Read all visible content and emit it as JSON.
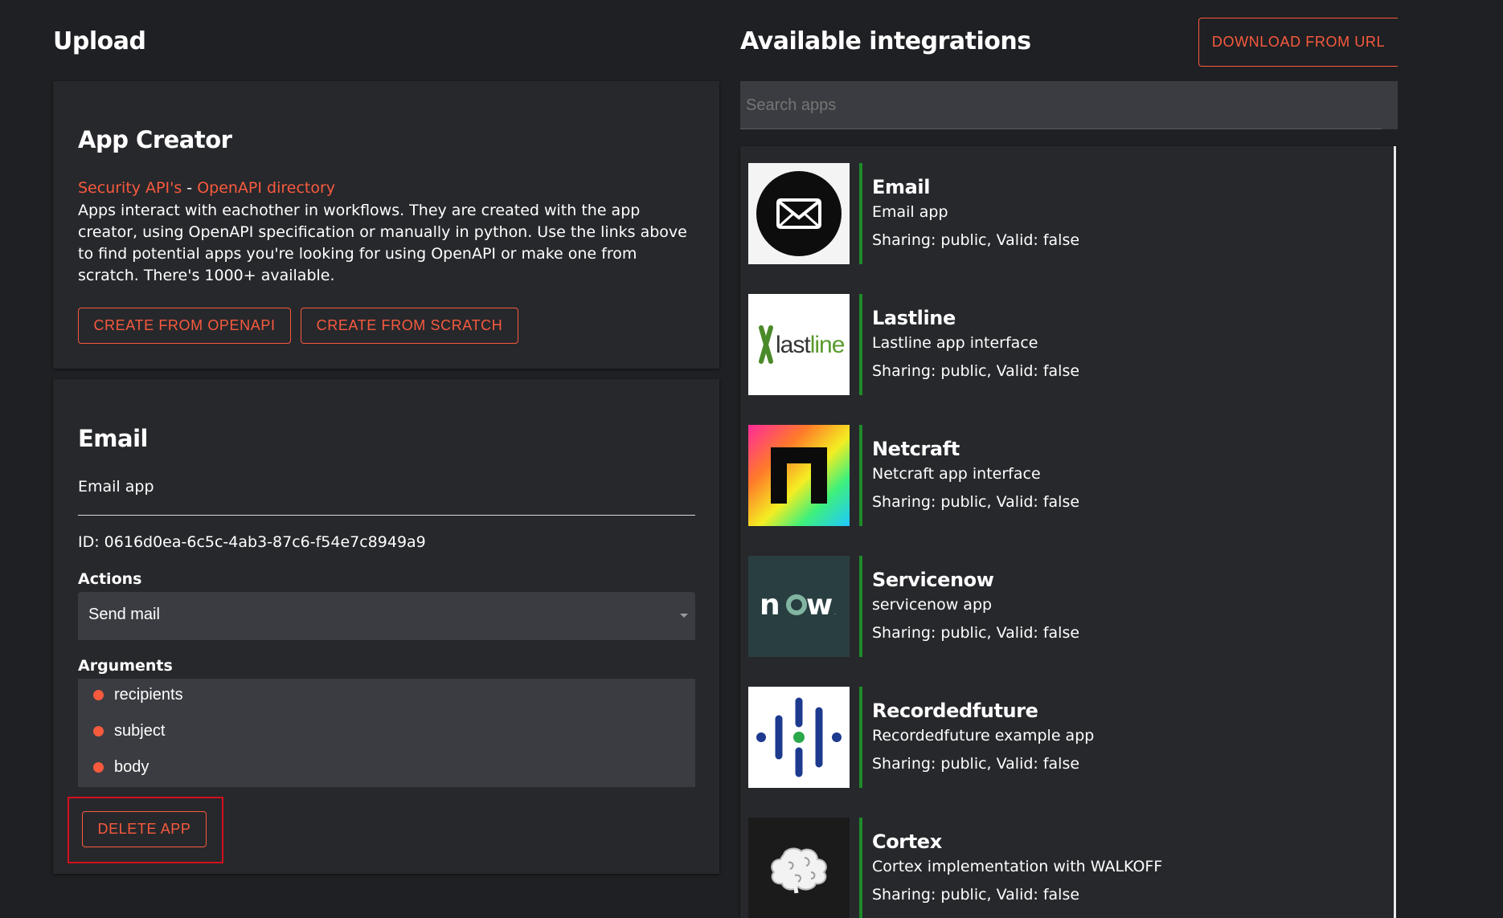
{
  "upload": {
    "title": "Upload"
  },
  "app_creator": {
    "title": "App Creator",
    "link_security": "Security API's",
    "separator": " - ",
    "link_openapi": "OpenAPI directory",
    "description": "Apps interact with eachother in workflows. They are created with the app creator, using OpenAPI specification or manually in python. Use the links above to find potential apps you're looking for using OpenAPI or make one from scratch. There's 1000+ available.",
    "btn_openapi": "CREATE FROM OPENAPI",
    "btn_scratch": "CREATE FROM SCRATCH"
  },
  "selected_app": {
    "name": "Email",
    "description": "Email app",
    "id_text": "ID: 0616d0ea-6c5c-4ab3-87c6-f54e7c8949a9",
    "actions_label": "Actions",
    "selected_action": "Send mail",
    "arguments_label": "Arguments",
    "arguments": [
      "recipients",
      "subject",
      "body"
    ],
    "delete_label": "DELETE APP"
  },
  "integrations": {
    "title": "Available integrations",
    "download_label": "DOWNLOAD FROM URL",
    "search_placeholder": "Search apps",
    "apps": [
      {
        "name": "Email",
        "description": "Email app",
        "sharing": "Sharing: public, Valid: false",
        "icon": "envelope-icon"
      },
      {
        "name": "Lastline",
        "description": "Lastline app interface",
        "sharing": "Sharing: public, Valid: false",
        "icon": "lastline-logo",
        "logo_text": "lastline"
      },
      {
        "name": "Netcraft",
        "description": "Netcraft app interface",
        "sharing": "Sharing: public, Valid: false",
        "icon": "netcraft-logo"
      },
      {
        "name": "Servicenow",
        "description": "servicenow app",
        "sharing": "Sharing: public, Valid: false",
        "icon": "servicenow-logo",
        "logo_text": "now"
      },
      {
        "name": "Recordedfuture",
        "description": "Recordedfuture example app",
        "sharing": "Sharing: public, Valid: false",
        "icon": "recordedfuture-logo"
      },
      {
        "name": "Cortex",
        "description": "Cortex implementation with WALKOFF",
        "sharing": "Sharing: public, Valid: false",
        "icon": "brain-icon"
      }
    ]
  },
  "colors": {
    "background": "#1f2023",
    "panel": "#27282c",
    "accent": "#f85a3e",
    "valid_bar": "#1e8a2a",
    "highlight_box": "#d4101c"
  }
}
